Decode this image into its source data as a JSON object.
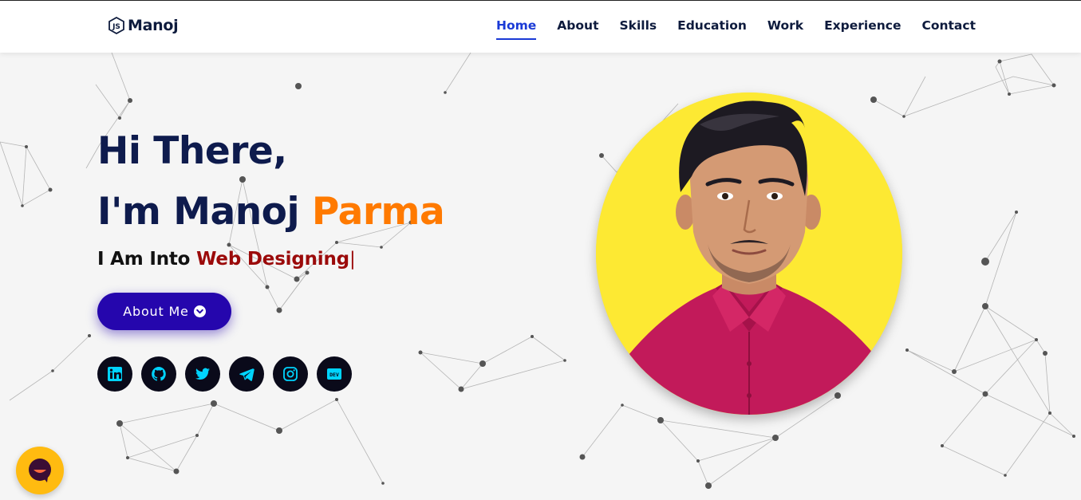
{
  "brand": {
    "name": "Manoj",
    "icon": "js-logo-icon"
  },
  "nav": {
    "items": [
      {
        "label": "Home",
        "active": true
      },
      {
        "label": "About",
        "active": false
      },
      {
        "label": "Skills",
        "active": false
      },
      {
        "label": "Education",
        "active": false
      },
      {
        "label": "Work",
        "active": false
      },
      {
        "label": "Experience",
        "active": false
      },
      {
        "label": "Contact",
        "active": false
      }
    ]
  },
  "hero": {
    "greeting": "Hi There,",
    "intro_prefix": "I'm Manoj ",
    "intro_name": "Parma",
    "typed_prefix": "I Am Into ",
    "typed_text": "Web Designing",
    "typed_cursor": "|",
    "button_label": "About Me",
    "button_icon": "chevron-down-circle-icon"
  },
  "socials": [
    {
      "name": "linkedin",
      "icon": "linkedin-icon"
    },
    {
      "name": "github",
      "icon": "github-icon"
    },
    {
      "name": "twitter",
      "icon": "twitter-icon"
    },
    {
      "name": "telegram",
      "icon": "telegram-icon"
    },
    {
      "name": "instagram",
      "icon": "instagram-icon"
    },
    {
      "name": "dev",
      "icon": "dev-icon",
      "text": "DEV"
    }
  ],
  "colors": {
    "accent": "#1a3ad6",
    "button": "#2506ad",
    "name_accent": "#ff7a00",
    "typed": "#9b0a0a",
    "heading": "#0e1b4d",
    "profile_bg": "#fde933",
    "social_icon": "#00d4ff",
    "chat": "#ffbb10"
  },
  "chat": {
    "icon": "chat-icon"
  }
}
